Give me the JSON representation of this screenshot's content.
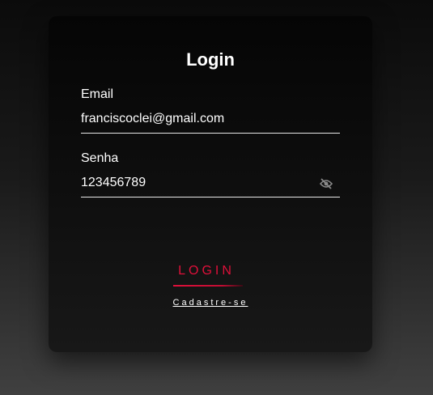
{
  "login_form": {
    "title": "Login",
    "email": {
      "label": "Email",
      "value": "franciscoclei@gmail.com"
    },
    "password": {
      "label": "Senha",
      "value": "123456789",
      "toggle_icon": "eye-off-icon"
    },
    "submit_label": "LOGIN",
    "signup_link": "Cadastre-se"
  },
  "colors": {
    "accent": "#e0103a",
    "text": "#ffffff",
    "card_background": "#0e0e0e"
  }
}
